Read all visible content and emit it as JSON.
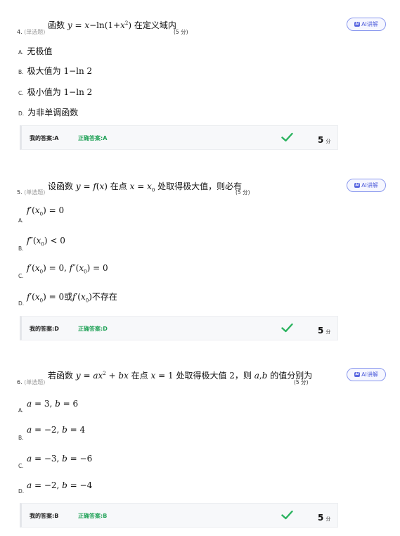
{
  "questions": [
    {
      "number": "4.",
      "type": "(单选题)",
      "stem_prefix": "函数",
      "stem_suffix": "在定义域内",
      "score": "(5 分)",
      "ai_label": "AI讲解",
      "options": [
        {
          "key": "A.",
          "text": "无极值"
        },
        {
          "key": "B.",
          "text": "极大值为"
        },
        {
          "key": "C.",
          "text": "极小值为"
        },
        {
          "key": "D.",
          "text": "为非单调函数"
        }
      ],
      "my_answer": "我的答案:A",
      "correct_answer": "正确答案:A",
      "points": "5",
      "points_unit": "分"
    },
    {
      "number": "5.",
      "type": "(单选题)",
      "stem_prefix": "设函数",
      "stem_middle": "在点",
      "stem_suffix": "处取得极大值，则必有",
      "score": "(5 分)",
      "ai_label": "AI讲解",
      "options": [
        {
          "key": "A.",
          "text": ""
        },
        {
          "key": "B.",
          "text": ""
        },
        {
          "key": "C.",
          "text": ""
        },
        {
          "key": "D.",
          "text": "或",
          "text2": "不存在"
        }
      ],
      "my_answer": "我的答案:D",
      "correct_answer": "正确答案:D",
      "points": "5",
      "points_unit": "分"
    },
    {
      "number": "6.",
      "type": "(单选题)",
      "stem_prefix": "若函数",
      "stem_middle": "在点",
      "stem_middle2": "处取得极大值",
      "stem_middle3": "，则",
      "stem_suffix": "的值分别为",
      "score": "(5 分)",
      "ai_label": "AI讲解",
      "options": [
        {
          "key": "A.",
          "text": ""
        },
        {
          "key": "B.",
          "text": ""
        },
        {
          "key": "C.",
          "text": ""
        },
        {
          "key": "D.",
          "text": ""
        }
      ],
      "my_answer": "我的答案:B",
      "correct_answer": "正确答案:B",
      "points": "5",
      "points_unit": "分"
    }
  ],
  "colors": {
    "correct": "#24a35a",
    "ai_accent": "#5462dc",
    "check": "#2bb35f"
  },
  "icons": {
    "ai": "ai-icon",
    "check": "check-icon"
  }
}
